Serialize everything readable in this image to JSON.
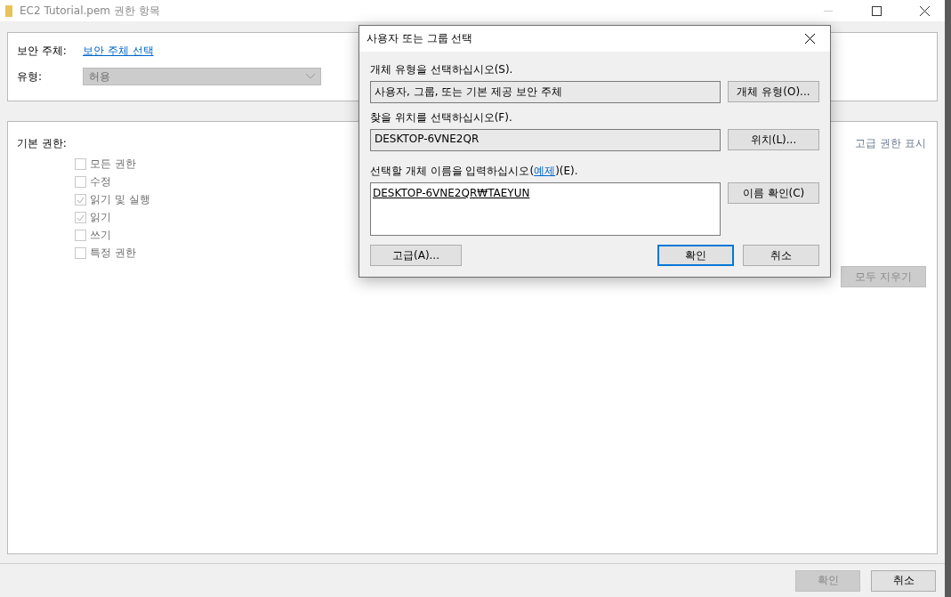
{
  "window": {
    "title": "EC2 Tutorial.pem 권한 항목"
  },
  "principal": {
    "label": "보안 주체:",
    "link": "보안 주체 선택"
  },
  "type": {
    "label": "유형:",
    "value": "허용",
    "disabled": true
  },
  "permissions": {
    "label": "기본 권한:",
    "advanced_link": "고급 권한 표시",
    "items": [
      {
        "label": "모든 권한",
        "checked": false,
        "disabled": true
      },
      {
        "label": "수정",
        "checked": false,
        "disabled": true
      },
      {
        "label": "읽기 및 실행",
        "checked": true,
        "disabled": true
      },
      {
        "label": "읽기",
        "checked": true,
        "disabled": true
      },
      {
        "label": "쓰기",
        "checked": false,
        "disabled": true
      },
      {
        "label": "특정 권한",
        "checked": false,
        "disabled": true
      }
    ],
    "clear_button": {
      "label": "모두 지우기",
      "disabled": true
    }
  },
  "footer_buttons": [
    {
      "label": "확인",
      "disabled": true
    },
    {
      "label": "취소",
      "disabled": false
    }
  ],
  "dialog": {
    "title": "사용자 또는 그룹 선택",
    "object_type": {
      "label": "개체 유형을 선택하십시오(S).",
      "value": "사용자, 그룹, 또는 기본 제공 보안 주체",
      "button": "개체 유형(O)..."
    },
    "location": {
      "label": "찾을 위치를 선택하십시오(F).",
      "value": "DESKTOP-6VNE2QR",
      "button": "위치(L)..."
    },
    "names": {
      "label_before": "선택할 개체 이름을 입력하십시오(",
      "link": "예제",
      "label_after": ")(E).",
      "value": "DESKTOP-6VNE2QR₩TAEYUN",
      "button": "이름 확인(C)"
    },
    "advanced_button": "고급(A)...",
    "buttons": [
      {
        "label": "확인",
        "kind": "default"
      },
      {
        "label": "취소",
        "kind": "normal"
      }
    ]
  }
}
